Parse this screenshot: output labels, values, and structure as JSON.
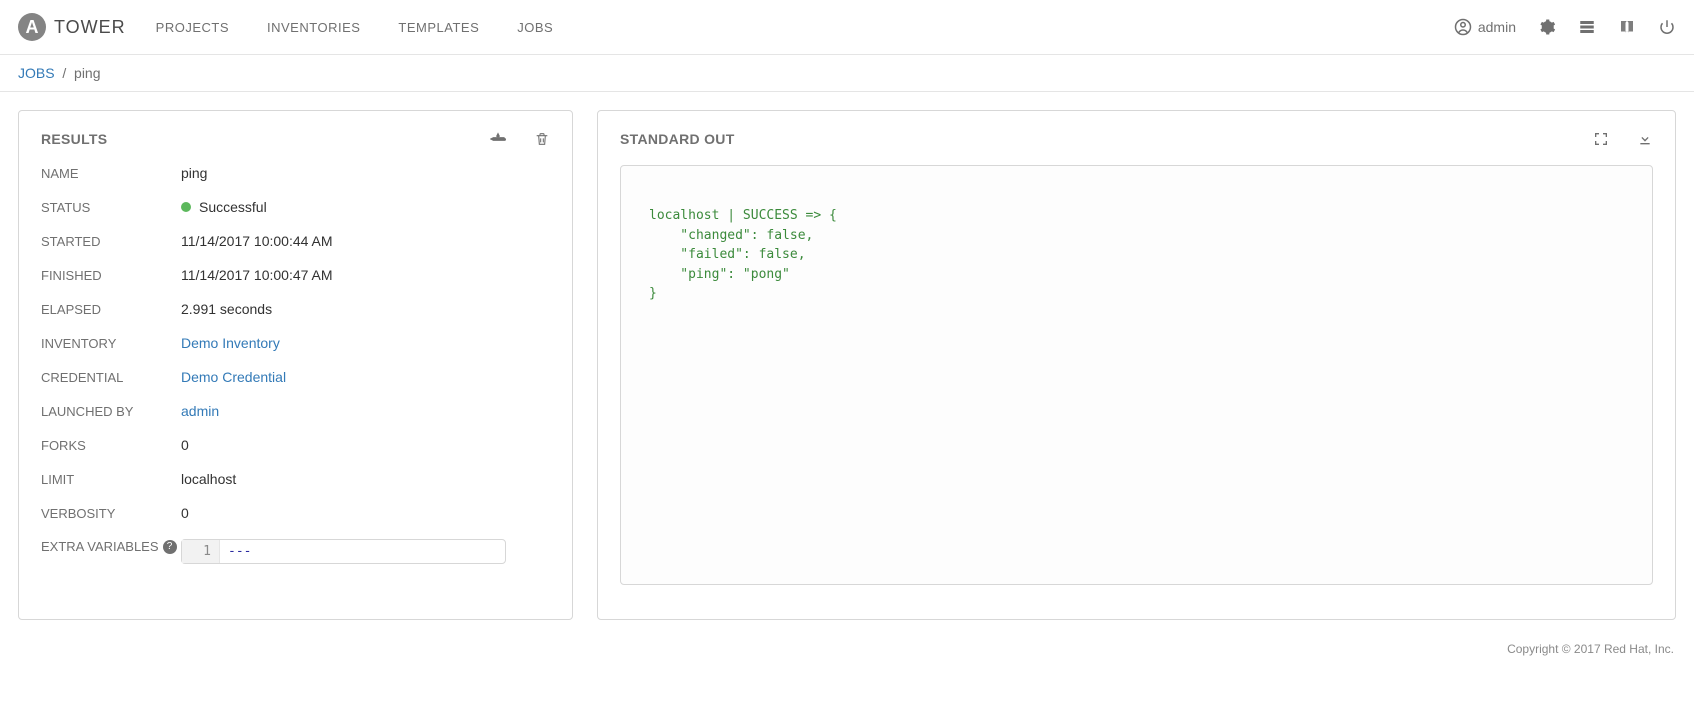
{
  "brand": {
    "initial": "A",
    "name": "TOWER"
  },
  "nav": {
    "projects": "PROJECTS",
    "inventories": "INVENTORIES",
    "templates": "TEMPLATES",
    "jobs": "JOBS"
  },
  "user": {
    "name": "admin"
  },
  "breadcrumb": {
    "root": "JOBS",
    "sep": "/",
    "current": "ping"
  },
  "results": {
    "title": "RESULTS",
    "labels": {
      "name": "NAME",
      "status": "STATUS",
      "started": "STARTED",
      "finished": "FINISHED",
      "elapsed": "ELAPSED",
      "inventory": "INVENTORY",
      "credential": "CREDENTIAL",
      "launched_by": "LAUNCHED BY",
      "forks": "FORKS",
      "limit": "LIMIT",
      "verbosity": "VERBOSITY",
      "extra_vars": "EXTRA VARIABLES"
    },
    "values": {
      "name": "ping",
      "status": "Successful",
      "started": "11/14/2017 10:00:44 AM",
      "finished": "11/14/2017 10:00:47 AM",
      "elapsed": "2.991 seconds",
      "inventory": "Demo Inventory",
      "credential": "Demo Credential",
      "launched_by": "admin",
      "forks": "0",
      "limit": "localhost",
      "verbosity": "0",
      "extra_vars_line_no": "1",
      "extra_vars_code": "---"
    }
  },
  "stdout": {
    "title": "STANDARD OUT",
    "text": "localhost | SUCCESS => {\n    \"changed\": false,\n    \"failed\": false,\n    \"ping\": \"pong\"\n}"
  },
  "footer": "Copyright © 2017 Red Hat, Inc."
}
